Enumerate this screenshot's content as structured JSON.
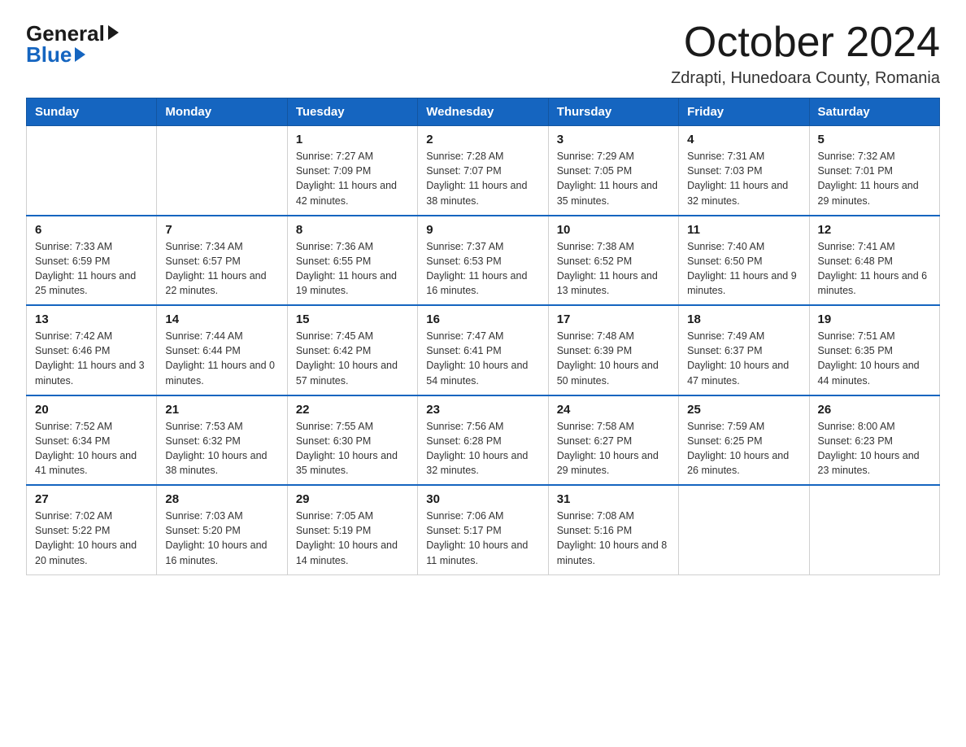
{
  "logo": {
    "general": "General",
    "blue": "Blue",
    "arrow": "▶"
  },
  "title": "October 2024",
  "location": "Zdrapti, Hunedoara County, Romania",
  "days_of_week": [
    "Sunday",
    "Monday",
    "Tuesday",
    "Wednesday",
    "Thursday",
    "Friday",
    "Saturday"
  ],
  "weeks": [
    [
      {
        "day": "",
        "sunrise": "",
        "sunset": "",
        "daylight": ""
      },
      {
        "day": "",
        "sunrise": "",
        "sunset": "",
        "daylight": ""
      },
      {
        "day": "1",
        "sunrise": "Sunrise: 7:27 AM",
        "sunset": "Sunset: 7:09 PM",
        "daylight": "Daylight: 11 hours and 42 minutes."
      },
      {
        "day": "2",
        "sunrise": "Sunrise: 7:28 AM",
        "sunset": "Sunset: 7:07 PM",
        "daylight": "Daylight: 11 hours and 38 minutes."
      },
      {
        "day": "3",
        "sunrise": "Sunrise: 7:29 AM",
        "sunset": "Sunset: 7:05 PM",
        "daylight": "Daylight: 11 hours and 35 minutes."
      },
      {
        "day": "4",
        "sunrise": "Sunrise: 7:31 AM",
        "sunset": "Sunset: 7:03 PM",
        "daylight": "Daylight: 11 hours and 32 minutes."
      },
      {
        "day": "5",
        "sunrise": "Sunrise: 7:32 AM",
        "sunset": "Sunset: 7:01 PM",
        "daylight": "Daylight: 11 hours and 29 minutes."
      }
    ],
    [
      {
        "day": "6",
        "sunrise": "Sunrise: 7:33 AM",
        "sunset": "Sunset: 6:59 PM",
        "daylight": "Daylight: 11 hours and 25 minutes."
      },
      {
        "day": "7",
        "sunrise": "Sunrise: 7:34 AM",
        "sunset": "Sunset: 6:57 PM",
        "daylight": "Daylight: 11 hours and 22 minutes."
      },
      {
        "day": "8",
        "sunrise": "Sunrise: 7:36 AM",
        "sunset": "Sunset: 6:55 PM",
        "daylight": "Daylight: 11 hours and 19 minutes."
      },
      {
        "day": "9",
        "sunrise": "Sunrise: 7:37 AM",
        "sunset": "Sunset: 6:53 PM",
        "daylight": "Daylight: 11 hours and 16 minutes."
      },
      {
        "day": "10",
        "sunrise": "Sunrise: 7:38 AM",
        "sunset": "Sunset: 6:52 PM",
        "daylight": "Daylight: 11 hours and 13 minutes."
      },
      {
        "day": "11",
        "sunrise": "Sunrise: 7:40 AM",
        "sunset": "Sunset: 6:50 PM",
        "daylight": "Daylight: 11 hours and 9 minutes."
      },
      {
        "day": "12",
        "sunrise": "Sunrise: 7:41 AM",
        "sunset": "Sunset: 6:48 PM",
        "daylight": "Daylight: 11 hours and 6 minutes."
      }
    ],
    [
      {
        "day": "13",
        "sunrise": "Sunrise: 7:42 AM",
        "sunset": "Sunset: 6:46 PM",
        "daylight": "Daylight: 11 hours and 3 minutes."
      },
      {
        "day": "14",
        "sunrise": "Sunrise: 7:44 AM",
        "sunset": "Sunset: 6:44 PM",
        "daylight": "Daylight: 11 hours and 0 minutes."
      },
      {
        "day": "15",
        "sunrise": "Sunrise: 7:45 AM",
        "sunset": "Sunset: 6:42 PM",
        "daylight": "Daylight: 10 hours and 57 minutes."
      },
      {
        "day": "16",
        "sunrise": "Sunrise: 7:47 AM",
        "sunset": "Sunset: 6:41 PM",
        "daylight": "Daylight: 10 hours and 54 minutes."
      },
      {
        "day": "17",
        "sunrise": "Sunrise: 7:48 AM",
        "sunset": "Sunset: 6:39 PM",
        "daylight": "Daylight: 10 hours and 50 minutes."
      },
      {
        "day": "18",
        "sunrise": "Sunrise: 7:49 AM",
        "sunset": "Sunset: 6:37 PM",
        "daylight": "Daylight: 10 hours and 47 minutes."
      },
      {
        "day": "19",
        "sunrise": "Sunrise: 7:51 AM",
        "sunset": "Sunset: 6:35 PM",
        "daylight": "Daylight: 10 hours and 44 minutes."
      }
    ],
    [
      {
        "day": "20",
        "sunrise": "Sunrise: 7:52 AM",
        "sunset": "Sunset: 6:34 PM",
        "daylight": "Daylight: 10 hours and 41 minutes."
      },
      {
        "day": "21",
        "sunrise": "Sunrise: 7:53 AM",
        "sunset": "Sunset: 6:32 PM",
        "daylight": "Daylight: 10 hours and 38 minutes."
      },
      {
        "day": "22",
        "sunrise": "Sunrise: 7:55 AM",
        "sunset": "Sunset: 6:30 PM",
        "daylight": "Daylight: 10 hours and 35 minutes."
      },
      {
        "day": "23",
        "sunrise": "Sunrise: 7:56 AM",
        "sunset": "Sunset: 6:28 PM",
        "daylight": "Daylight: 10 hours and 32 minutes."
      },
      {
        "day": "24",
        "sunrise": "Sunrise: 7:58 AM",
        "sunset": "Sunset: 6:27 PM",
        "daylight": "Daylight: 10 hours and 29 minutes."
      },
      {
        "day": "25",
        "sunrise": "Sunrise: 7:59 AM",
        "sunset": "Sunset: 6:25 PM",
        "daylight": "Daylight: 10 hours and 26 minutes."
      },
      {
        "day": "26",
        "sunrise": "Sunrise: 8:00 AM",
        "sunset": "Sunset: 6:23 PM",
        "daylight": "Daylight: 10 hours and 23 minutes."
      }
    ],
    [
      {
        "day": "27",
        "sunrise": "Sunrise: 7:02 AM",
        "sunset": "Sunset: 5:22 PM",
        "daylight": "Daylight: 10 hours and 20 minutes."
      },
      {
        "day": "28",
        "sunrise": "Sunrise: 7:03 AM",
        "sunset": "Sunset: 5:20 PM",
        "daylight": "Daylight: 10 hours and 16 minutes."
      },
      {
        "day": "29",
        "sunrise": "Sunrise: 7:05 AM",
        "sunset": "Sunset: 5:19 PM",
        "daylight": "Daylight: 10 hours and 14 minutes."
      },
      {
        "day": "30",
        "sunrise": "Sunrise: 7:06 AM",
        "sunset": "Sunset: 5:17 PM",
        "daylight": "Daylight: 10 hours and 11 minutes."
      },
      {
        "day": "31",
        "sunrise": "Sunrise: 7:08 AM",
        "sunset": "Sunset: 5:16 PM",
        "daylight": "Daylight: 10 hours and 8 minutes."
      },
      {
        "day": "",
        "sunrise": "",
        "sunset": "",
        "daylight": ""
      },
      {
        "day": "",
        "sunrise": "",
        "sunset": "",
        "daylight": ""
      }
    ]
  ]
}
